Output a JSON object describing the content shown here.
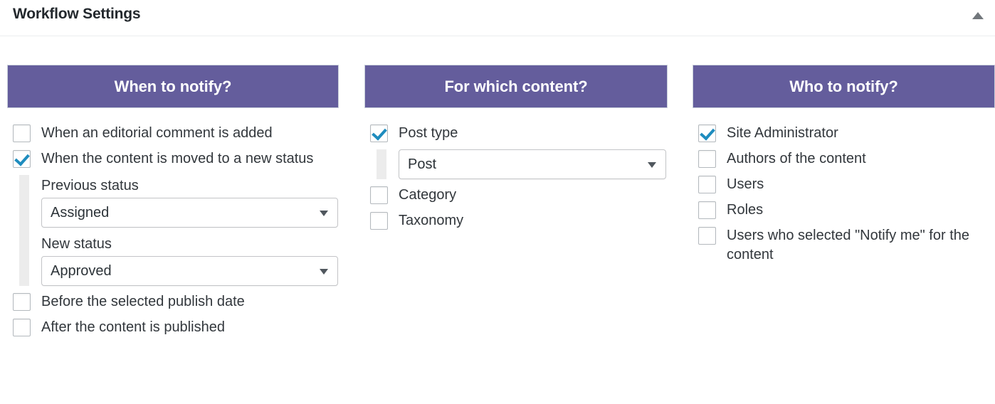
{
  "panel": {
    "title": "Workflow Settings",
    "collapse_icon": "caret-up-icon"
  },
  "colors": {
    "header_purple": "#645d9c",
    "checkmark_blue": "#1e8cbe",
    "indent_bar_gray": "#ececec"
  },
  "columns": [
    {
      "id": "when-to-notify",
      "header": "When to notify?",
      "items": [
        {
          "kind": "checkbox",
          "label": "When an editorial comment is added",
          "checked": false
        },
        {
          "kind": "checkbox",
          "label": "When the content is moved to a new status",
          "checked": true
        },
        {
          "kind": "sub-block",
          "fields": [
            {
              "label": "Previous status",
              "value": "Assigned"
            },
            {
              "label": "New status",
              "value": "Approved"
            }
          ]
        },
        {
          "kind": "checkbox",
          "label": "Before the selected publish date",
          "checked": false
        },
        {
          "kind": "checkbox",
          "label": "After the content is published",
          "checked": false
        }
      ]
    },
    {
      "id": "for-which-content",
      "header": "For which content?",
      "items": [
        {
          "kind": "checkbox",
          "label": "Post type",
          "checked": true
        },
        {
          "kind": "sub-block",
          "fields": [
            {
              "label": "",
              "value": "Post"
            }
          ]
        },
        {
          "kind": "checkbox",
          "label": "Category",
          "checked": false
        },
        {
          "kind": "checkbox",
          "label": "Taxonomy",
          "checked": false
        }
      ]
    },
    {
      "id": "who-to-notify",
      "header": "Who to notify?",
      "items": [
        {
          "kind": "checkbox",
          "label": "Site Administrator",
          "checked": true
        },
        {
          "kind": "checkbox",
          "label": "Authors of the content",
          "checked": false
        },
        {
          "kind": "checkbox",
          "label": "Users",
          "checked": false
        },
        {
          "kind": "checkbox",
          "label": "Roles",
          "checked": false
        },
        {
          "kind": "checkbox",
          "label": "Users who selected \"Notify me\" for the content",
          "checked": false
        }
      ]
    }
  ]
}
